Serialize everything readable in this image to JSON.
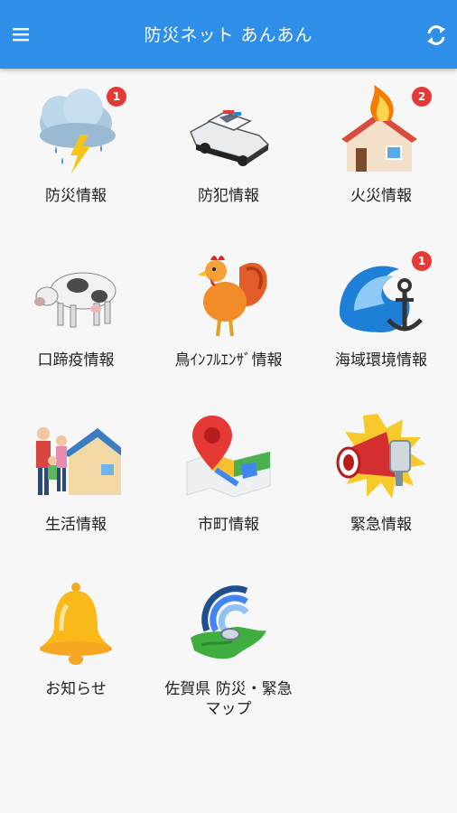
{
  "app": {
    "title": "防災ネット あんあん",
    "menu_icon": "hamburger-menu-icon",
    "refresh_icon": "refresh-icon",
    "accent": "#2f8ee8"
  },
  "tiles": [
    {
      "label": "防災情報",
      "icon": "thunderstorm-cloud-icon",
      "badge": "1"
    },
    {
      "label": "防犯情報",
      "icon": "police-car-icon",
      "badge": ""
    },
    {
      "label": "火災情報",
      "icon": "burning-house-icon",
      "badge": "2"
    },
    {
      "label": "口蹄疫情報",
      "icon": "cow-icon",
      "badge": ""
    },
    {
      "label": "鳥ｲﾝﾌﾙｴﾝｻﾞ情報",
      "icon": "rooster-icon",
      "badge": ""
    },
    {
      "label": "海域環境情報",
      "icon": "wave-anchor-icon",
      "badge": "1"
    },
    {
      "label": "生活情報",
      "icon": "family-house-icon",
      "badge": ""
    },
    {
      "label": "市町情報",
      "icon": "map-pin-icon",
      "badge": ""
    },
    {
      "label": "緊急情報",
      "icon": "megaphone-icon",
      "badge": ""
    },
    {
      "label": "お知らせ",
      "icon": "bell-icon",
      "badge": ""
    },
    {
      "label": "佐賀県 防災・緊急\nマップ",
      "icon": "map-signal-icon",
      "badge": ""
    }
  ]
}
